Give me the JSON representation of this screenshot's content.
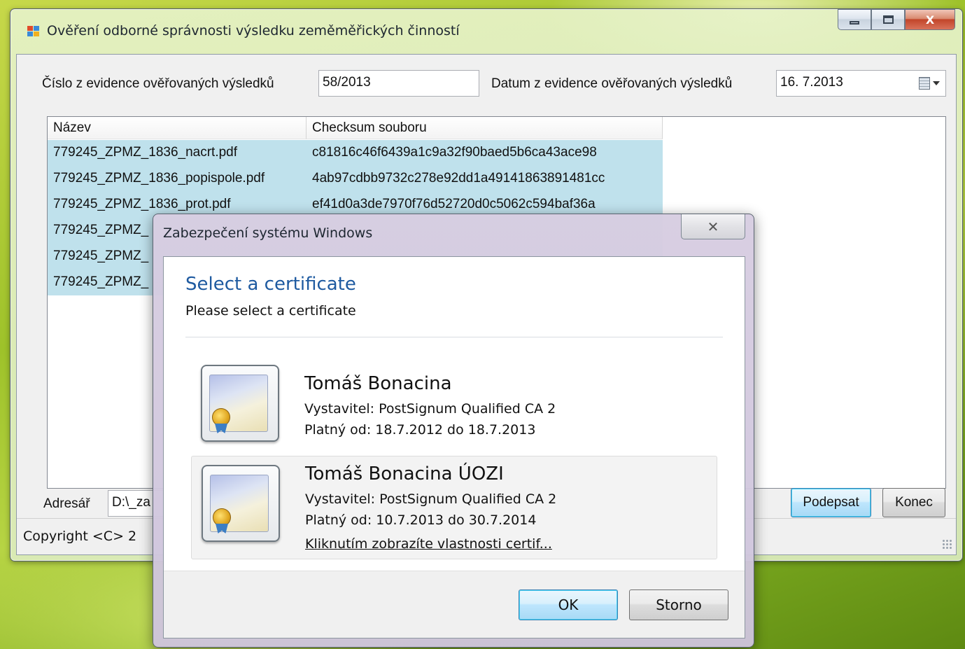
{
  "main_window": {
    "title": "Ověření odborné správnosti výsledku zeměměřických činností",
    "caption": {
      "minimize_icon": "minimize-icon",
      "maximize_icon": "maximize-icon",
      "close_glyph": "X"
    },
    "evidence_number_label": "Číslo z evidence ověřovaných výsledků",
    "evidence_number_value": "58/2013",
    "evidence_date_label": "Datum z evidence ověřovaných výsledků",
    "evidence_date_value": "16.  7.2013",
    "file_list": {
      "columns": [
        "Název",
        "Checksum souboru"
      ],
      "rows": [
        {
          "name": "779245_ZPMZ_1836_nacrt.pdf",
          "checksum": "c81816c46f6439a1c9a32f90baed5b6ca43ace98"
        },
        {
          "name": "779245_ZPMZ_1836_popispole.pdf",
          "checksum": "4ab97cdbb9732c278e92dd1a49141863891481cc"
        },
        {
          "name": "779245_ZPMZ_1836_prot.pdf",
          "checksum": "ef41d0a3de7970f76d52720d0c5062c594baf36a"
        },
        {
          "name": "779245_ZPMZ_",
          "checksum": ""
        },
        {
          "name": "779245_ZPMZ_",
          "checksum": ""
        },
        {
          "name": "779245_ZPMZ_",
          "checksum": ""
        }
      ]
    },
    "directory_label": "Adresář",
    "directory_value": "D:\\_za",
    "sign_button": "Podepsat",
    "end_button": "Konec",
    "status_text": "Copyright <C> 2"
  },
  "dialog": {
    "title": "Zabezpečení systému Windows",
    "close_glyph": "✕",
    "heading": "Select a certificate",
    "subheading": "Please select a certificate",
    "certificates": [
      {
        "name": "Tomáš Bonacina",
        "issuer": "Vystavitel: PostSignum Qualified CA 2",
        "validity": "Platný od: 18.7.2012 do 18.7.2013",
        "link": ""
      },
      {
        "name": "Tomáš Bonacina ÚOZI",
        "issuer": "Vystavitel: PostSignum Qualified CA 2",
        "validity": "Platný od: 10.7.2013 do 30.7.2014",
        "link": "Kliknutím zobrazíte vlastnosti certif..."
      }
    ],
    "selected_index": 1,
    "ok_button": "OK",
    "cancel_button": "Storno"
  },
  "colors": {
    "selection": "#bfe1ec",
    "heading_blue": "#1e5aa0",
    "close_red": "#c2452a"
  }
}
